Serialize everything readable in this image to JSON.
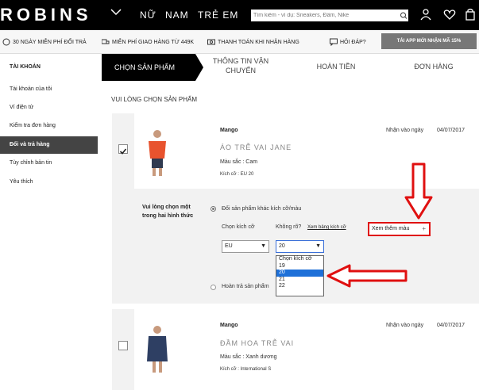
{
  "header": {
    "logo": "ROBINS",
    "nav": [
      "NỮ",
      "NAM",
      "TRẺ EM"
    ],
    "search_placeholder": "Tìm kiếm - ví dụ: Sneakers, Đầm, Nike"
  },
  "promo": {
    "items": [
      "30 NGÀY MIỄN PHÍ ĐỔI TRẢ",
      "MIỄN PHÍ GIAO HÀNG TỪ 449K",
      "THANH TOÁN KHI NHẬN HÀNG",
      "HỎI ĐÁP?"
    ],
    "app_button": "TẢI APP MỚI NHẬN MÃ 15%"
  },
  "sidebar": {
    "title": "TÀI KHOẢN",
    "items": [
      "Tài khoản của tôi",
      "Ví điện tử",
      "Kiểm tra đơn hàng",
      "Đổi và trả hàng",
      "Tùy chỉnh bản tin",
      "Yêu thích"
    ],
    "active_index": 3
  },
  "steps": {
    "items": [
      "CHỌN SẢN PHẨM",
      "THÔNG TIN VẬN CHUYỂN",
      "HOÀN TIỀN",
      "ĐƠN HÀNG"
    ],
    "active_index": 0
  },
  "section_title": "VUI LÒNG CHỌN SẢN PHẨM",
  "products": [
    {
      "brand": "Mango",
      "name": "ÁO TRỄ VAI JANE",
      "color_label": "Màu sắc : Cam",
      "size_label": "Kích cỡ : EU 20",
      "received_label": "Nhận vào ngày",
      "date": "04/07/2017",
      "checked": true,
      "image_color": "#e8532e"
    },
    {
      "brand": "Mango",
      "name": "ĐẦM HOA TRỄ VAI",
      "color_label": "Màu sắc : Xanh dương",
      "size_label": "Kích cỡ : International S",
      "received_label": "Nhận vào ngày",
      "date": "04/07/2017",
      "checked": false,
      "image_color": "#2e3f63"
    }
  ],
  "options": {
    "prompt": "Vui lòng chọn một trong hai hình thức",
    "exchange_label": "Đổi sản phẩm khác kích cỡ/màu",
    "choose_size_label": "Chọn kích cỡ",
    "unsure_label": "Không rõ?",
    "size_chart_link": "Xem bảng kích cỡ",
    "size_system": "EU",
    "size_value": "20",
    "size_options": [
      "Chọn kích cỡ",
      "19",
      "20",
      "21",
      "22"
    ],
    "size_selected_index": 2,
    "more_colors": "Xem thêm màu",
    "refund_label": "Hoàn trả sản phẩm"
  },
  "colors": {
    "annotation_red": "#e01010",
    "dropdown_highlight": "#1e70d8"
  }
}
